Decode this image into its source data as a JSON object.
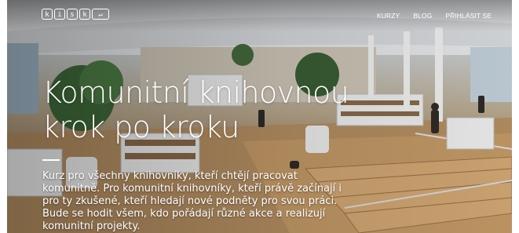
{
  "header": {
    "logo_keys": [
      "k",
      "i",
      "s",
      "k",
      "↵"
    ],
    "nav": [
      {
        "label": "KURZY"
      },
      {
        "label": "BLOG"
      },
      {
        "label": "PŘIHLÁSIT SE"
      }
    ]
  },
  "hero": {
    "title_line1": "Komunitní knihovnou",
    "title_line2": "krok po kroku",
    "lead": "Kurz pro všechny knihovníky, kteří chtějí pracovat komunitně. Pro komunitní knihovníky, kteří právě začínají i pro ty zkušené, kteří hledají nové podněty pro svou práci. Bude se hodit všem, kdo pořádají různé akce a realizují komunitní projekty."
  }
}
